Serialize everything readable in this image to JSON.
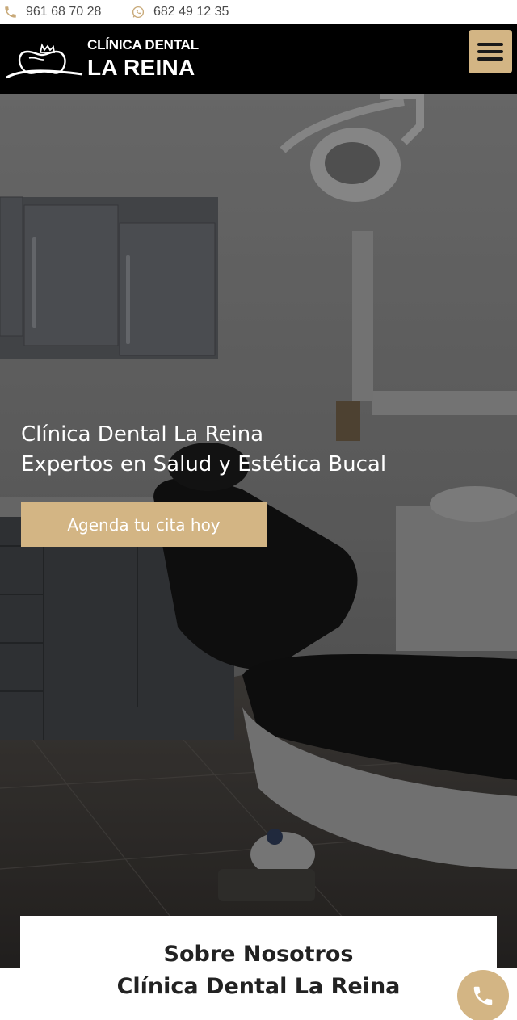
{
  "topbar": {
    "phone_primary": "961 68 70 28",
    "phone_primary_icon": "phone-icon",
    "phone_whatsapp": "682 49 12 35",
    "phone_whatsapp_icon": "whatsapp-icon"
  },
  "header": {
    "logo_line1": "CLÍNICA DENTAL",
    "logo_line2": "LA REINA",
    "logo_icon": "tooth-crown-logo",
    "menu_icon": "hamburger-menu-icon"
  },
  "hero": {
    "title_line1": "Clínica Dental La Reina",
    "title_line2": "Expertos en Salud y Estética Bucal",
    "cta_label": "Agenda tu cita hoy"
  },
  "about": {
    "title_line1": "Sobre Nosotros",
    "title_line2": "Clínica Dental La Reina"
  },
  "floating": {
    "call_icon": "phone-icon"
  },
  "colors": {
    "accent": "#d3b584",
    "header_bg": "#000000",
    "topbar_text": "#4a4a4a",
    "hero_overlay": "#3c3c3c"
  }
}
